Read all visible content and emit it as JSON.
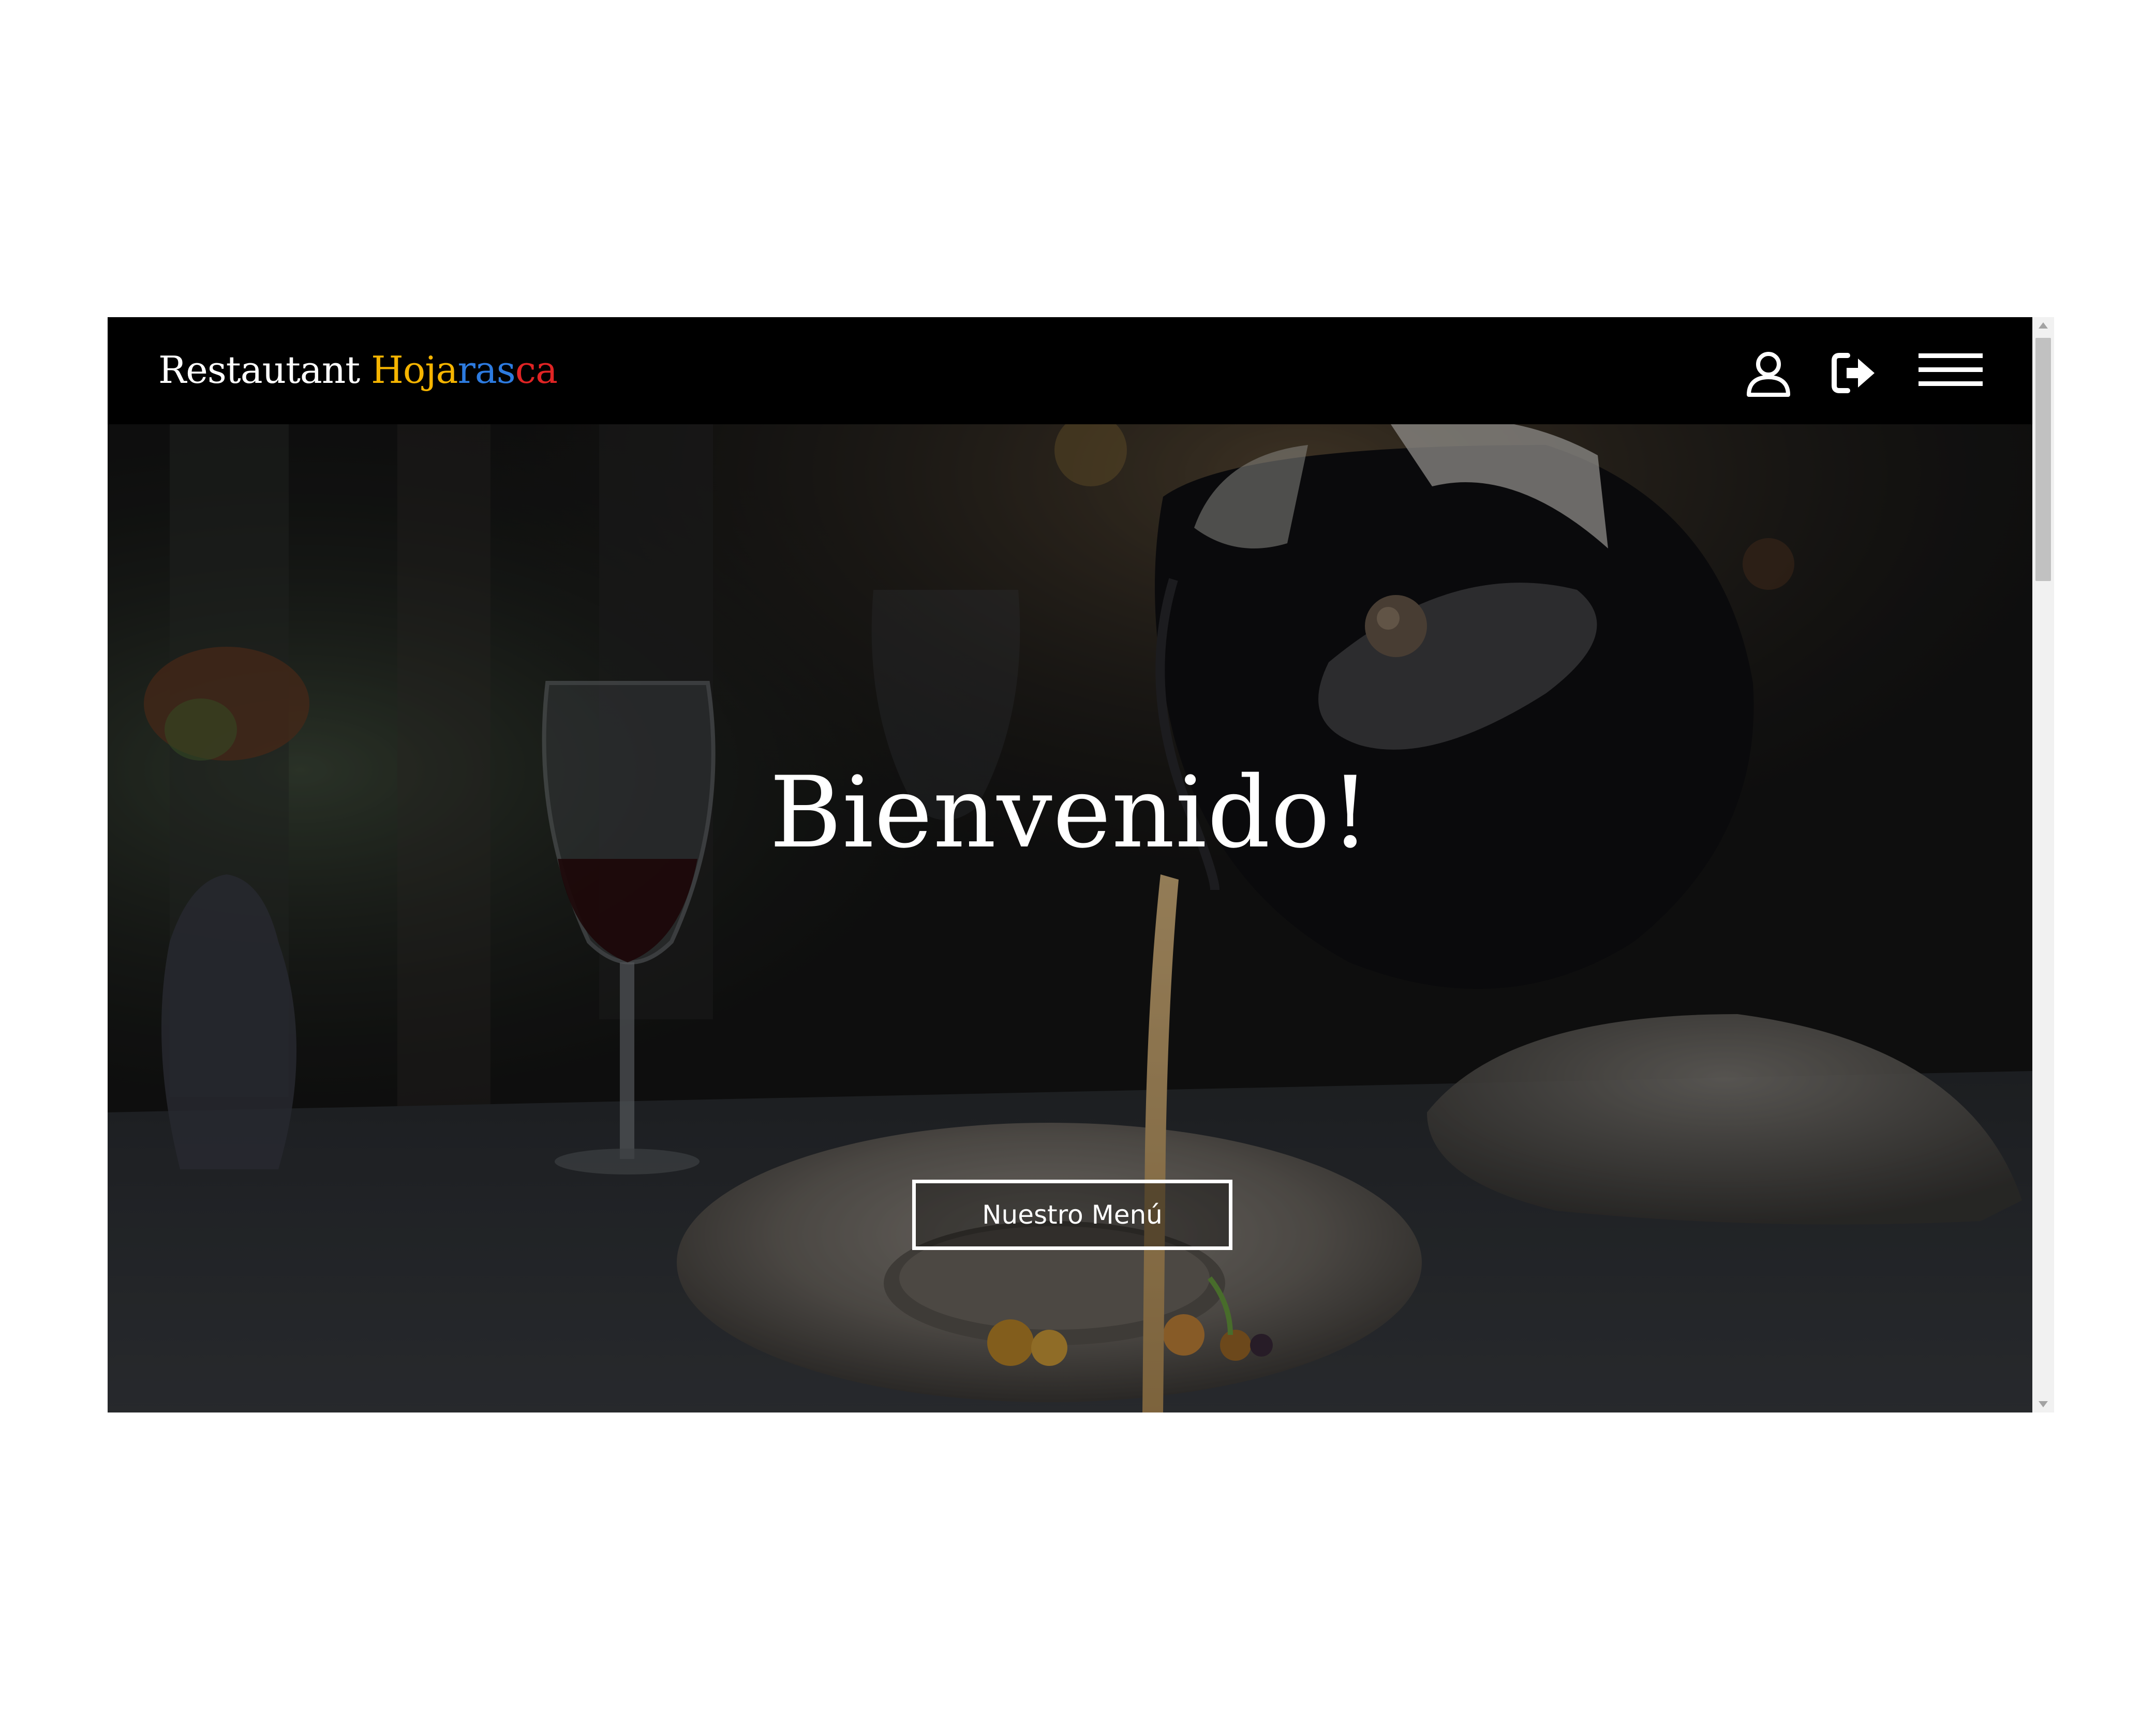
{
  "header": {
    "brand_first": "Restautant",
    "brand_parts": [
      {
        "text": "Hoja",
        "color": "#f5b400"
      },
      {
        "text": "ras",
        "color": "#2d7be0"
      },
      {
        "text": "ca",
        "color": "#e02424"
      }
    ],
    "icons": [
      "user-icon",
      "sign-out-icon",
      "hamburger-menu-icon"
    ]
  },
  "hero": {
    "title": "Bienvenido!",
    "button_label": "Nuestro Menú"
  },
  "colors": {
    "navbar": "#000000",
    "text": "#ffffff"
  }
}
